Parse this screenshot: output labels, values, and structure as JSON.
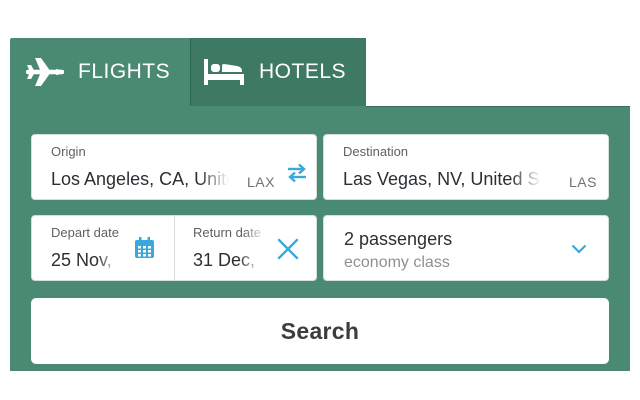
{
  "tabs": {
    "flights": {
      "label": "FLIGHTS",
      "icon": "airplane-icon",
      "active": true
    },
    "hotels": {
      "label": "HOTELS",
      "icon": "bed-icon",
      "active": false
    }
  },
  "origin": {
    "label": "Origin",
    "value": "Los Angeles, CA, United States",
    "code": "LAX"
  },
  "destination": {
    "label": "Destination",
    "value": "Las Vegas, NV, United States",
    "code": "LAS"
  },
  "swap": {
    "icon": "swap-arrows-icon"
  },
  "depart": {
    "label": "Depart date",
    "value": "25 Nov,",
    "icon": "calendar-icon"
  },
  "return": {
    "label": "Return date",
    "value": "31 Dec,",
    "clear_icon": "close-icon"
  },
  "passengers": {
    "count_text": "2 passengers",
    "class_text": "economy class",
    "icon": "chevron-down-icon"
  },
  "search": {
    "label": "Search"
  },
  "colors": {
    "accent": "#4a8a72",
    "tab_inactive": "#3e7a63",
    "icon_blue": "#39a9dc"
  }
}
